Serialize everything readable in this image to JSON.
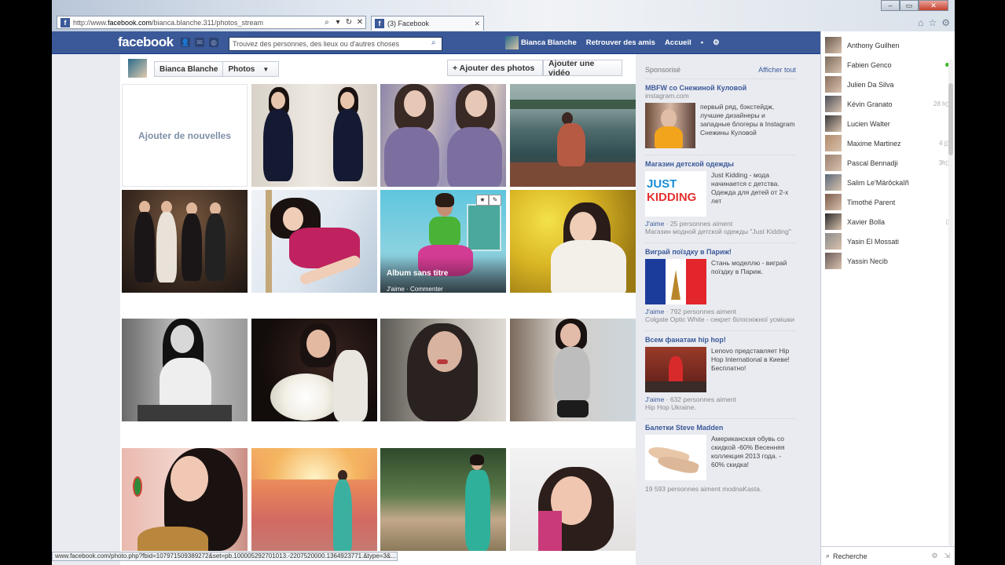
{
  "browser": {
    "url_prefix": "http://www.",
    "url_domain": "facebook.com",
    "url_rest": "/bianca.blanche.311/photos_stream",
    "tab_title": "(3) Facebook",
    "status_url": "www.facebook.com/photo.php?fbid=107971509389272&set=pb.100005292701013.-2207520000.1364923771.&type=3&..."
  },
  "fb": {
    "logo": "facebook",
    "search_placeholder": "Trouvez des personnes, des lieux ou d'autres choses",
    "nav": {
      "user": "Bianca Blanche",
      "find_friends": "Retrouver des amis",
      "home": "Accueil"
    }
  },
  "photos": {
    "crumb_name": "Bianca Blanche",
    "crumb_section": "Photos",
    "add_photos": "+ Ajouter des photos",
    "add_video": "Ajouter une vidéo",
    "add_new": "Ajouter de nouvelles",
    "album_title": "Album sans titre",
    "album_actions": "J'aime · Commenter"
  },
  "ads": {
    "sponsored": "Sponsorisé",
    "show_all": "Afficher tout",
    "items": [
      {
        "title": "MBFW со Снежиной Куловой",
        "domain": "instagram.com",
        "text": "первый ряд, бэкстейдж, лучшие дизайнеры и западные блогеры в Instagram Снежины Куловой"
      },
      {
        "title": "Магазин детской одежды",
        "text": "Just Kidding - мода начинается с детства. Одежда для детей от 2-х лет",
        "like": "J'aime",
        "count": " · 25 personnes aiment",
        "social": "Магазин модной детской одежды \"Just Kidding\""
      },
      {
        "title": "Виграй поїздку в Париж!",
        "text": "Стань моделлю - виграй поїздку в Париж.",
        "like": "J'aime",
        "count": " · 792 personnes aiment",
        "social": "Colgate Optic White - секрет білосніжної усмішки"
      },
      {
        "title": "Всем фанатам hip hop!",
        "text": "Lenovo представляет Hip Hop International в Киеве! Бесплатно!",
        "like": "J'aime",
        "count": " · 632 personnes aiment",
        "social": "Hip Hop Ukraine."
      },
      {
        "title": "Балетки Steve Madden",
        "text": "Американская обувь со скидкой -60% Весенняя коллекция 2013 года. - 60% скидка!",
        "social": "19 593 personnes aiment modnaKasta."
      }
    ]
  },
  "chat": {
    "friends": [
      {
        "name": "Anthony Guilhen",
        "status": ""
      },
      {
        "name": "Fabien Genco",
        "status": "online"
      },
      {
        "name": "Julien Da Silva",
        "status": ""
      },
      {
        "name": "Kévin Granato",
        "status": "28 h"
      },
      {
        "name": "Lucien Walter",
        "status": ""
      },
      {
        "name": "Maxime Martinez",
        "status": "4 j"
      },
      {
        "name": "Pascal Bennadji",
        "status": "3h"
      },
      {
        "name": "Salim Le'Märôckaîñ",
        "status": ""
      },
      {
        "name": "Timothé Parent",
        "status": ""
      },
      {
        "name": "Xavier Bolla",
        "status": "mobile"
      },
      {
        "name": "Yasin El Mossati",
        "status": ""
      },
      {
        "name": "Yassin Necib",
        "status": ""
      }
    ],
    "search": "Recherche"
  }
}
